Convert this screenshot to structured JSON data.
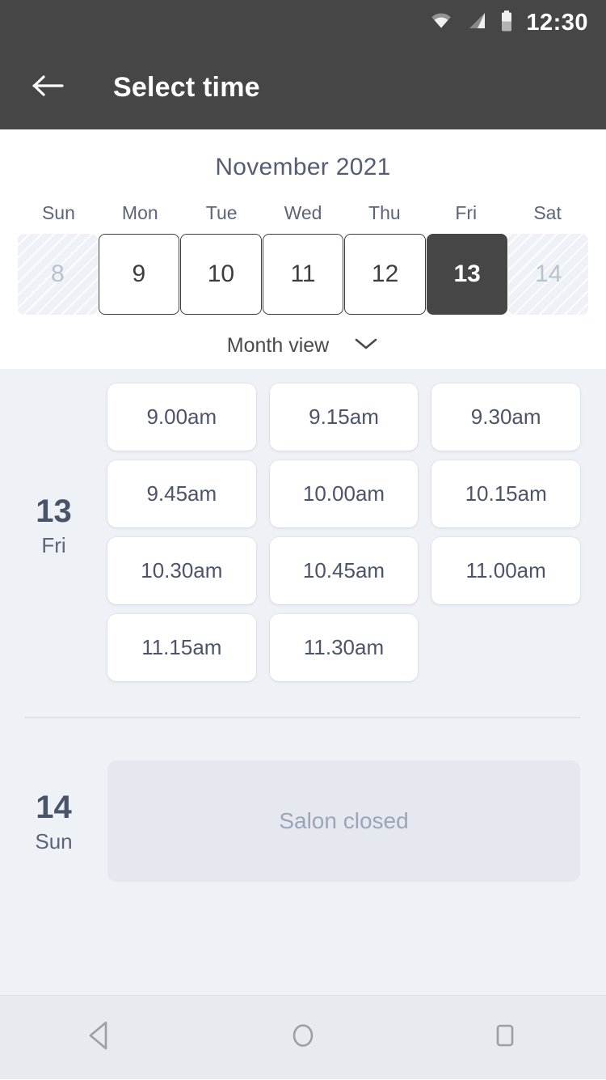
{
  "status_bar": {
    "time": "12:30",
    "icons": [
      "wifi-icon",
      "cellular-signal-icon",
      "battery-icon"
    ]
  },
  "app_bar": {
    "back_icon": "back-arrow-icon",
    "title": "Select time"
  },
  "calendar": {
    "month_title": "November 2021",
    "weekdays": [
      "Sun",
      "Mon",
      "Tue",
      "Wed",
      "Thu",
      "Fri",
      "Sat"
    ],
    "dates": [
      {
        "num": "8",
        "state": "disabled"
      },
      {
        "num": "9",
        "state": "available"
      },
      {
        "num": "10",
        "state": "available"
      },
      {
        "num": "11",
        "state": "available"
      },
      {
        "num": "12",
        "state": "available"
      },
      {
        "num": "13",
        "state": "selected"
      },
      {
        "num": "14",
        "state": "disabled"
      }
    ],
    "view_toggle": {
      "label": "Month view",
      "icon": "chevron-down-icon"
    }
  },
  "days": [
    {
      "day_num": "13",
      "day_of_week": "Fri",
      "slots": [
        "9.00am",
        "9.15am",
        "9.30am",
        "9.45am",
        "10.00am",
        "10.15am",
        "10.30am",
        "10.45am",
        "11.00am",
        "11.15am",
        "11.30am"
      ]
    },
    {
      "day_num": "14",
      "day_of_week": "Sun",
      "closed_message": "Salon closed"
    }
  ],
  "nav_bar": {
    "back": "nav-back-icon",
    "home": "nav-home-icon",
    "recents": "nav-recents-icon"
  },
  "colors": {
    "app_bar_bg": "#464646",
    "page_bg": "#eef1f5",
    "accent_text": "#4a5468",
    "selected_day_bg": "#464646",
    "slot_card_bg": "#ffffff",
    "closed_card_bg": "#e5e9ef"
  }
}
